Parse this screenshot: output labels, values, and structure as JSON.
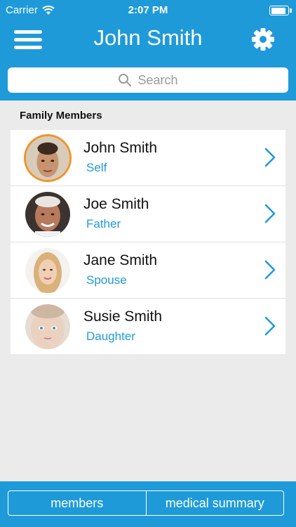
{
  "status_bar": {
    "carrier": "Carrier",
    "time": "2:07 PM",
    "battery_level": 0.95,
    "wifi_icon": "wifi-icon"
  },
  "nav": {
    "title": "John Smith",
    "menu_icon": "menu-icon",
    "settings_icon": "gear-icon"
  },
  "search": {
    "placeholder": "Search",
    "icon": "search-icon"
  },
  "section": {
    "title": "Family Members"
  },
  "members": [
    {
      "name": "John Smith",
      "relation": "Self",
      "selected": true
    },
    {
      "name": "Joe Smith",
      "relation": "Father",
      "selected": false
    },
    {
      "name": "Jane Smith",
      "relation": "Spouse",
      "selected": false
    },
    {
      "name": "Susie Smith",
      "relation": "Daughter",
      "selected": false
    }
  ],
  "tabs": [
    {
      "label": "members"
    },
    {
      "label": "medical summary"
    }
  ],
  "colors": {
    "brand_blue": "#1e9ad9",
    "selection_orange": "#f0932b",
    "background": "#ebebeb"
  }
}
